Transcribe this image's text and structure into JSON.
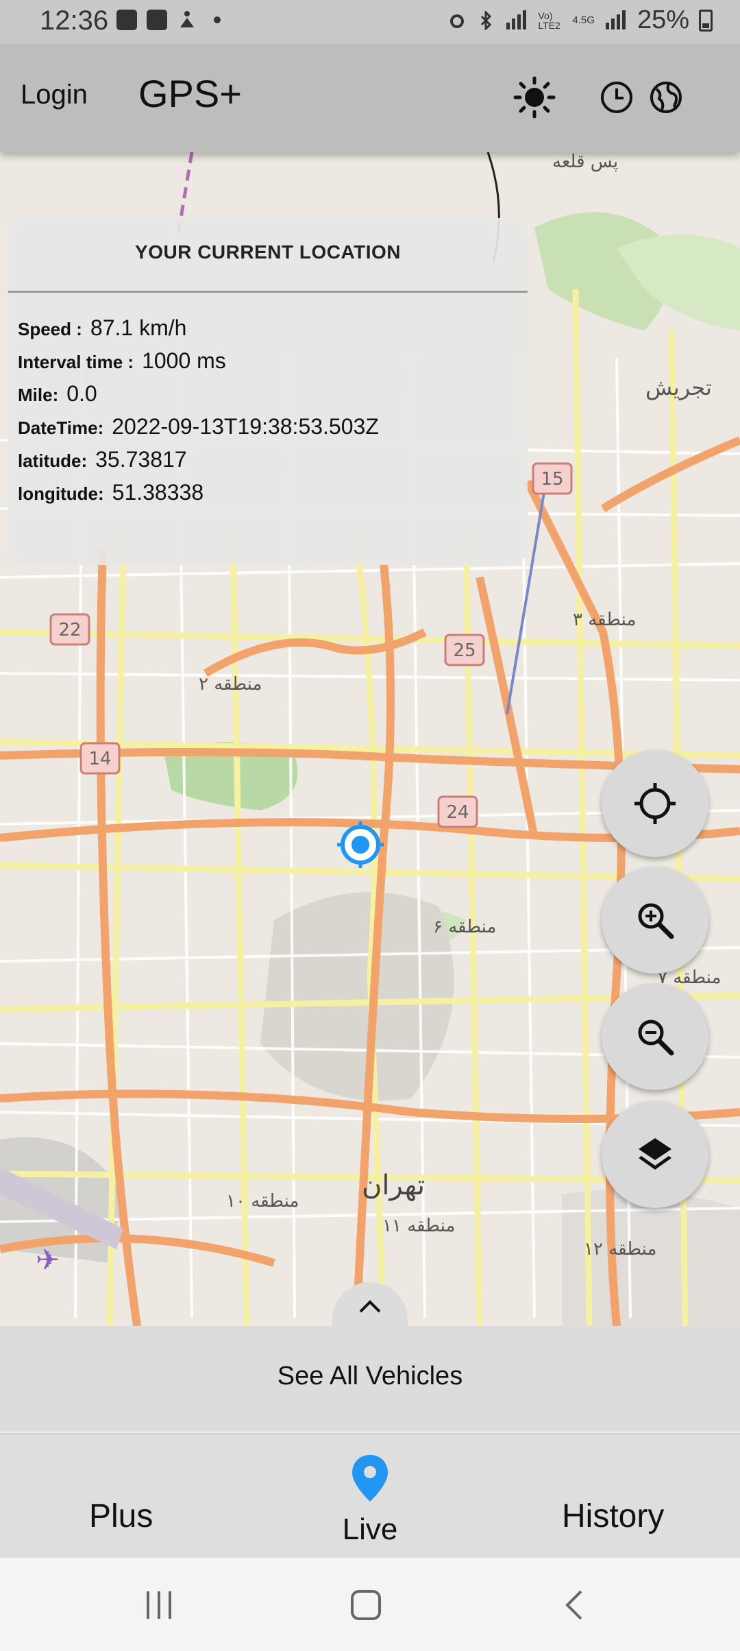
{
  "status_bar": {
    "time": "12:36",
    "left_icons": [
      "image-icon",
      "app-icon",
      "accessibility-icon",
      "dot-icon"
    ],
    "right_icons": [
      "alarm-icon",
      "bluetooth-icon",
      "signal-icon",
      "volte-icon",
      "4g-icon",
      "signal-bars-icon"
    ],
    "volte_text": "Vo) LTE2",
    "net_text": "4.5G",
    "battery": "25%"
  },
  "app_bar": {
    "login_label": "Login",
    "title": "GPS+",
    "icons": [
      "brightness-icon",
      "clock-icon",
      "globe-icon"
    ]
  },
  "location_card": {
    "title": "YOUR CURRENT LOCATION",
    "rows": [
      {
        "label": "Speed :",
        "value": "87.1 km/h"
      },
      {
        "label": "Interval time :",
        "value": "1000 ms"
      },
      {
        "label": "Mile:",
        "value": "0.0"
      },
      {
        "label": "DateTime:",
        "value": "2022-09-13T19:38:53.503Z"
      },
      {
        "label": "latitude:",
        "value": "35.73817"
      },
      {
        "label": "longitude:",
        "value": "51.38338"
      }
    ]
  },
  "map": {
    "labels": {
      "pas_ghaleh": "پس قلعه",
      "tajrish": "تجریش",
      "region3": "منطقه ۳",
      "region2": "منطقه ۲",
      "region6": "منطقه ۶",
      "region7": "منطقه ۷",
      "region10": "منطقه ۱۰",
      "tehran": "تهران",
      "region11": "منطقه ۱۱",
      "region12": "منطقه ۱۲"
    },
    "shields": [
      "15",
      "22",
      "25",
      "14",
      "24"
    ]
  },
  "fabs": [
    "my-location-icon",
    "zoom-in-icon",
    "zoom-out-icon",
    "layers-icon"
  ],
  "bottom_sheet": {
    "label": "See All Vehicles"
  },
  "bottom_nav": {
    "plus": "Plus",
    "live": "Live",
    "history": "History"
  },
  "colors": {
    "accent": "#2196f3",
    "app_bar": "#bdbdbd",
    "sheet": "#dcdcdc"
  }
}
